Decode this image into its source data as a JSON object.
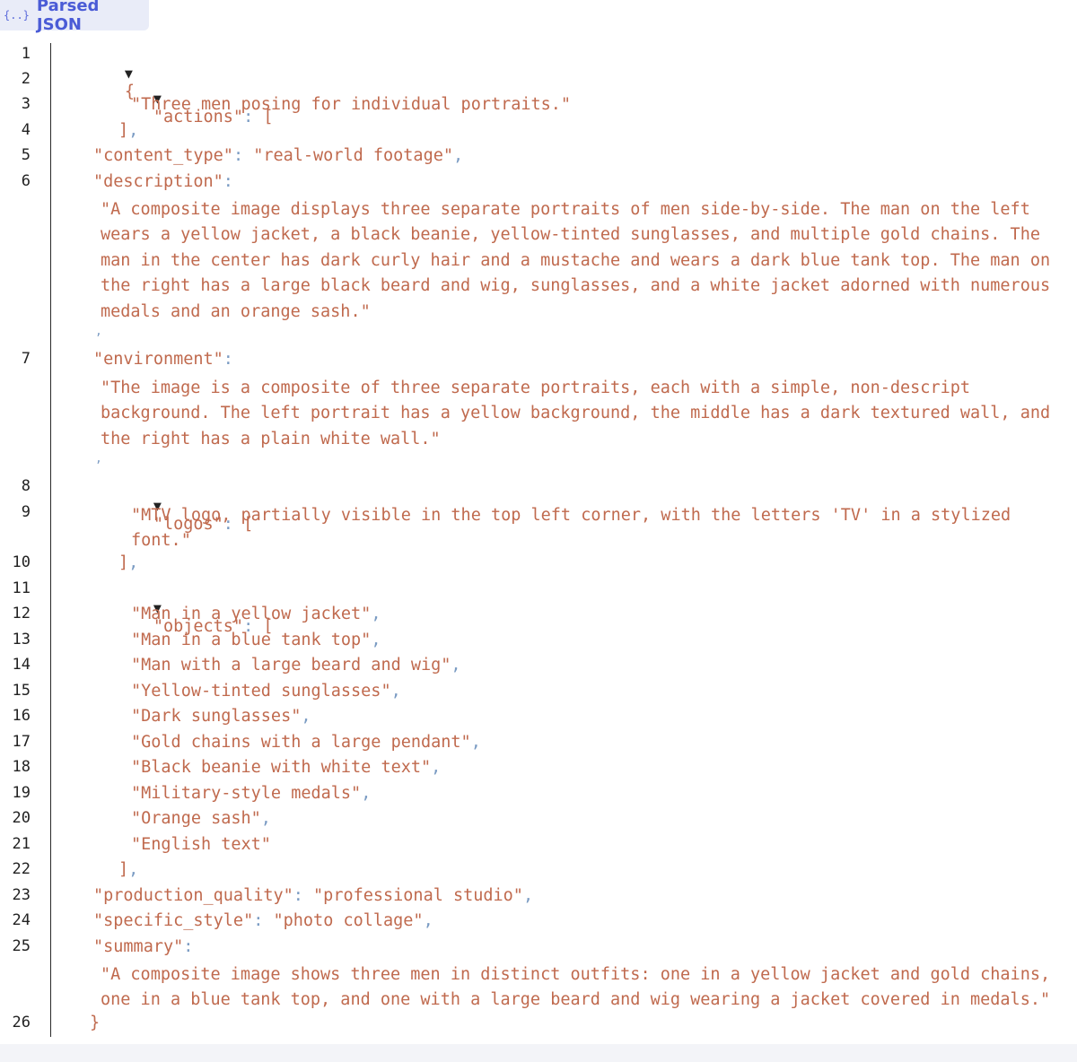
{
  "tab": {
    "icon": "{..}",
    "label": "Parsed JSON"
  },
  "lines": {
    "actions_key": "\"actions\"",
    "actions_item": "\"Three men posing for individual portraits.\"",
    "content_type_key": "\"content_type\"",
    "content_type_val": "\"real-world footage\"",
    "description_key": "\"description\"",
    "description_val": "\"A composite image displays three separate portraits of men side-by-side. The man on the left wears a yellow jacket, a black beanie, yellow-tinted sunglasses, and multiple gold chains. The man in the center has dark curly hair and a mustache and wears a dark blue tank top. The man on the right has a large black beard and wig, sunglasses, and a white jacket adorned with numerous medals and an orange sash.\"",
    "environment_key": "\"environment\"",
    "environment_val": "\"The image is a composite of three separate portraits, each with a simple, non-descript background. The left portrait has a yellow background, the middle has a dark textured wall, and the right has a plain white wall.\"",
    "logos_key": "\"logos\"",
    "logos_item": "\"MTV logo, partially visible in the top left corner, with the letters 'TV' in a stylized font.\"",
    "objects_key": "\"objects\"",
    "objects_items": [
      "\"Man in a yellow jacket\"",
      "\"Man in a blue tank top\"",
      "\"Man with a large beard and wig\"",
      "\"Yellow-tinted sunglasses\"",
      "\"Dark sunglasses\"",
      "\"Gold chains with a large pendant\"",
      "\"Black beanie with white text\"",
      "\"Military-style medals\"",
      "\"Orange sash\"",
      "\"English text\""
    ],
    "production_quality_key": "\"production_quality\"",
    "production_quality_val": "\"professional studio\"",
    "specific_style_key": "\"specific_style\"",
    "specific_style_val": "\"photo collage\"",
    "summary_key": "\"summary\"",
    "summary_val": "\"A composite image shows three men in distinct outfits: one in a yellow jacket and gold chains, one in a blue tank top, and one with a large beard and wig wearing a jacket covered in medals.\""
  },
  "line_numbers": [
    "1",
    "2",
    "3",
    "4",
    "5",
    "6",
    "7",
    "8",
    "9",
    "10",
    "11",
    "12",
    "13",
    "14",
    "15",
    "16",
    "17",
    "18",
    "19",
    "20",
    "21",
    "22",
    "23",
    "24",
    "25",
    "26"
  ],
  "glyphs": {
    "toggle": "▼",
    "open_brace": "{",
    "close_brace": "}",
    "open_bracket": "[",
    "close_bracket": "]",
    "colon": ":",
    "comma": ","
  },
  "colors": {
    "string": "#c06a4e",
    "punctuation": "#7a9bc3",
    "tab_accent": "#4a5bd6"
  }
}
